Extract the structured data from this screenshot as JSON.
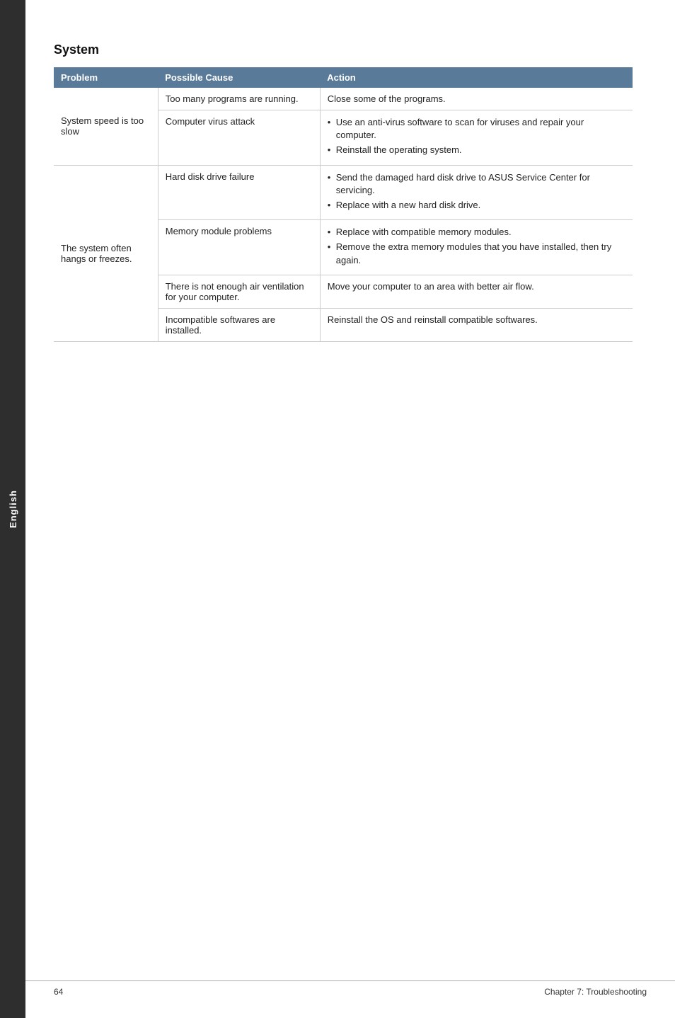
{
  "sidebar": {
    "label": "English"
  },
  "section": {
    "title": "System"
  },
  "table": {
    "headers": {
      "problem": "Problem",
      "cause": "Possible Cause",
      "action": "Action"
    },
    "rows": [
      {
        "problem": "System speed is too slow",
        "cause": "Too many programs are running.",
        "action_type": "text",
        "action": "Close some of the programs."
      },
      {
        "problem": "",
        "cause": "Computer virus attack",
        "action_type": "bullets",
        "action_bullets": [
          "Use an anti-virus software to scan for viruses and repair your computer.",
          "Reinstall the operating system."
        ]
      },
      {
        "problem": "The system often hangs or freezes.",
        "cause": "Hard disk drive failure",
        "action_type": "bullets",
        "action_bullets": [
          "Send the damaged hard disk drive to ASUS Service Center for servicing.",
          "Replace with a new hard disk drive."
        ]
      },
      {
        "problem": "",
        "cause": "Memory module problems",
        "action_type": "bullets",
        "action_bullets": [
          "Replace with compatible memory modules.",
          "Remove the extra memory modules that you have installed, then try again."
        ]
      },
      {
        "problem": "",
        "cause": "There is not enough air ventilation for your computer.",
        "action_type": "text",
        "action": "Move your computer to an area with better air flow."
      },
      {
        "problem": "",
        "cause": "Incompatible softwares are installed.",
        "action_type": "text",
        "action": "Reinstall the OS and reinstall compatible softwares."
      }
    ]
  },
  "footer": {
    "page_number": "64",
    "chapter": "Chapter 7: Troubleshooting"
  }
}
